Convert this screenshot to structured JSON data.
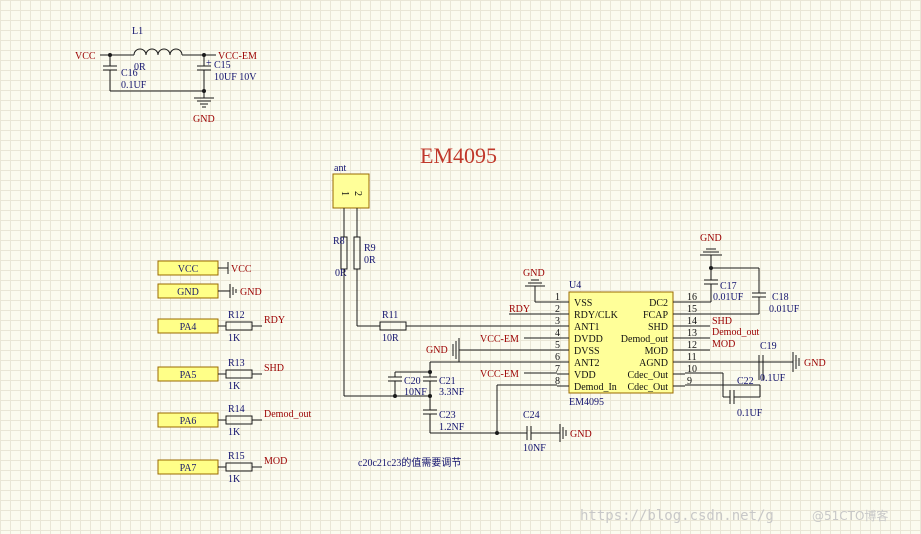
{
  "title": "EM4095",
  "note": "c20c21c23的值需要调节",
  "watermark": "https://blog.csdn.net/g",
  "watermark_logo": "@51CTO博客",
  "power": {
    "vcc": "VCC",
    "vcc_em": "VCC-EM",
    "gnd": "GND",
    "l1": "L1",
    "l1_val": "0R",
    "c16": "C16",
    "c16_val": "0.1UF",
    "c15": "C15",
    "c15_val": "10UF 10V",
    "plus": "+"
  },
  "antenna": {
    "name": "ant",
    "pin1": "1",
    "pin2": "2",
    "r8": "R8",
    "r8_val": "0R",
    "r9": "R9",
    "r9_val": "0R"
  },
  "ports": [
    {
      "label": "VCC",
      "net": "VCC"
    },
    {
      "label": "GND",
      "net": "GND"
    },
    {
      "label": "PA4",
      "net": "RDY",
      "res": "R12",
      "res_val": "1K"
    },
    {
      "label": "PA5",
      "net": "SHD",
      "res": "R13",
      "res_val": "1K"
    },
    {
      "label": "PA6",
      "net": "Demod_out",
      "res": "R14",
      "res_val": "1K"
    },
    {
      "label": "PA7",
      "net": "MOD",
      "res": "R15",
      "res_val": "1K"
    }
  ],
  "ic": {
    "ref": "U4",
    "name": "EM4095",
    "left_pins": [
      {
        "num": "1",
        "name": "VSS"
      },
      {
        "num": "2",
        "name": "RDY/CLK"
      },
      {
        "num": "3",
        "name": "ANT1"
      },
      {
        "num": "4",
        "name": "DVDD"
      },
      {
        "num": "5",
        "name": "DVSS"
      },
      {
        "num": "6",
        "name": "ANT2"
      },
      {
        "num": "7",
        "name": "VDD"
      },
      {
        "num": "8",
        "name": "Demod_In"
      }
    ],
    "right_pins": [
      {
        "num": "16",
        "name": "DC2"
      },
      {
        "num": "15",
        "name": "FCAP"
      },
      {
        "num": "14",
        "name": "SHD"
      },
      {
        "num": "13",
        "name": "Demod_out"
      },
      {
        "num": "12",
        "name": "MOD"
      },
      {
        "num": "11",
        "name": "AGND"
      },
      {
        "num": "10",
        "name": "Cdec_Out"
      },
      {
        "num": "9",
        "name": "Cdec_Out"
      }
    ]
  },
  "nets": {
    "rdy": "RDY",
    "shd": "SHD",
    "demod": "Demod_out",
    "mod": "MOD",
    "vcc_em": "VCC-EM",
    "gnd": "GND",
    "gnd_dot": "GND"
  },
  "parts": {
    "r11": "R11",
    "r11_val": "10R",
    "c17": "C17",
    "c17_val": "0.01UF",
    "c18": "C18",
    "c18_val": "0.01UF",
    "c19": "C19",
    "c19_val": "0.1UF",
    "c22": "C22",
    "c22_val": "0.1UF",
    "c20": "C20",
    "c20_val": "10NF",
    "c21": "C21",
    "c21_val": "3.3NF",
    "c23": "C23",
    "c23_val": "1.2NF",
    "c24": "C24",
    "c24_val": "10NF"
  },
  "colors": {
    "wire": "#1a1a1a",
    "label_blue": "#12126e",
    "net_red": "#9b0000",
    "port_fill": "#ffff88",
    "title": "#c0392b"
  }
}
